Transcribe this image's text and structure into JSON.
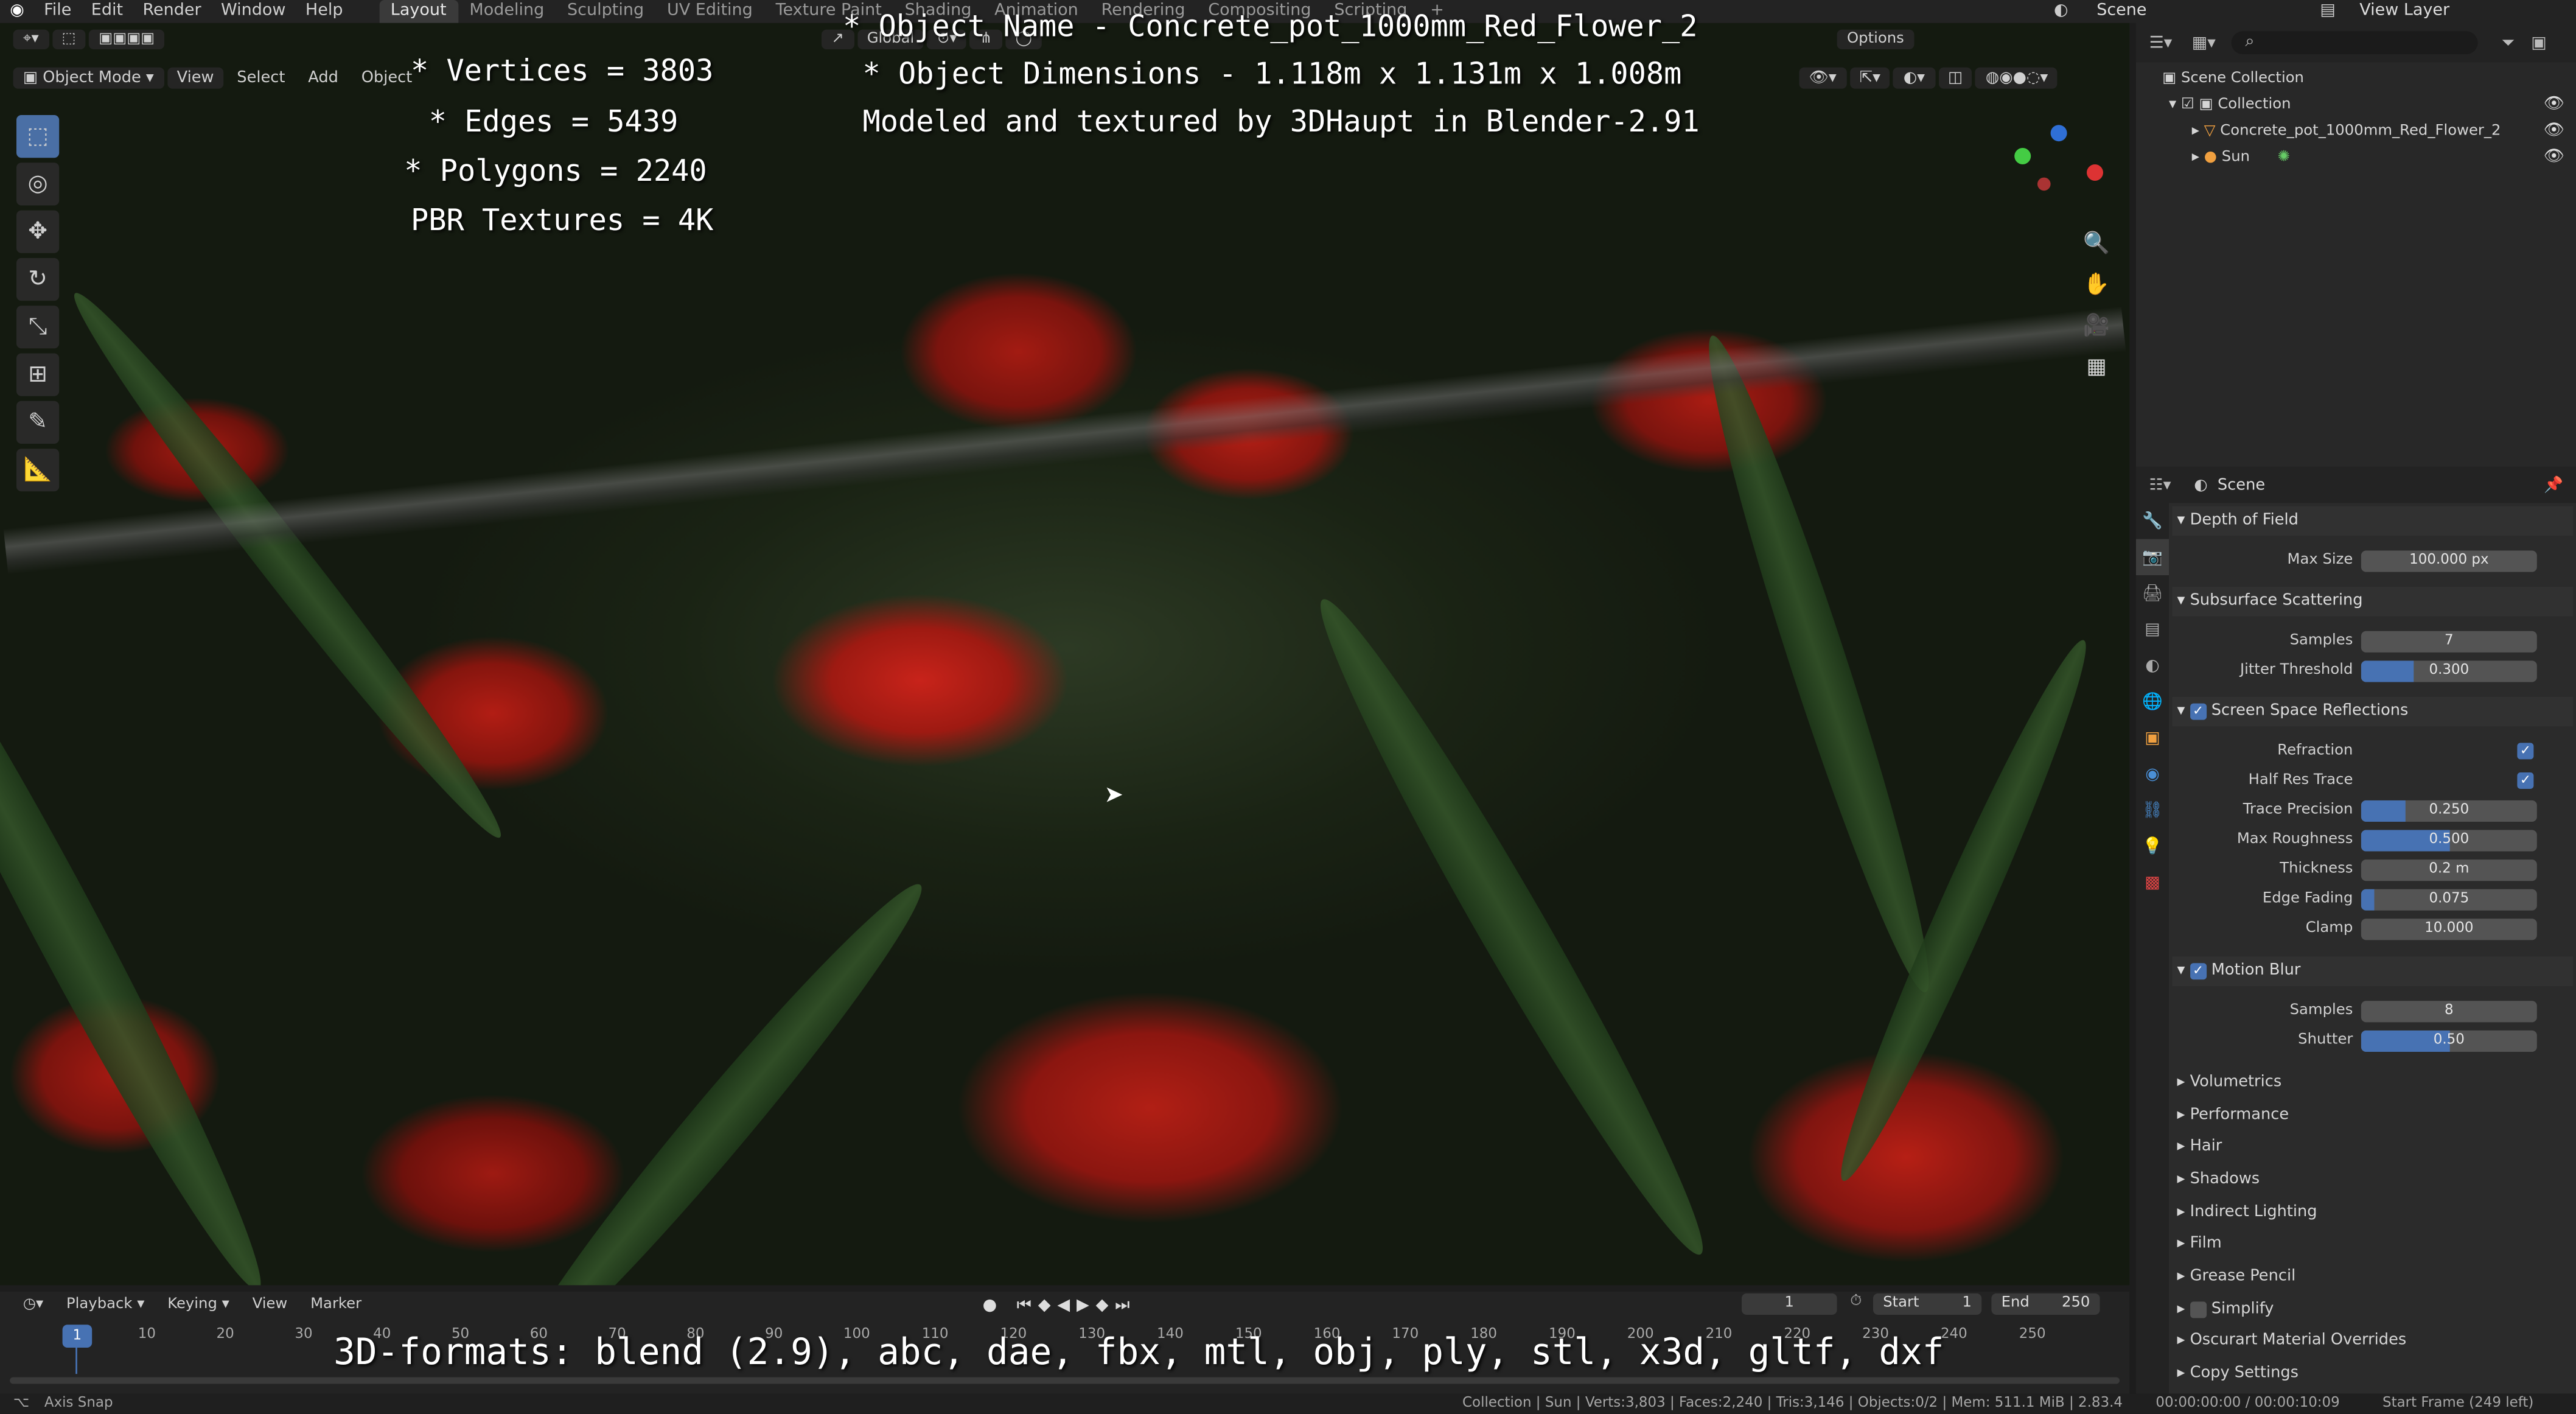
{
  "menu": {
    "items": [
      "File",
      "Edit",
      "Render",
      "Window",
      "Help"
    ]
  },
  "workspaces": [
    "Layout",
    "Modeling",
    "Sculpting",
    "UV Editing",
    "Texture Paint",
    "Shading",
    "Animation",
    "Rendering",
    "Compositing",
    "Scripting"
  ],
  "topright": {
    "scene": "Scene",
    "view_layer": "View Layer"
  },
  "viewport": {
    "mode": "Object Mode",
    "menus": [
      "View",
      "Select",
      "Add",
      "Object"
    ],
    "orientation": "Global",
    "options": "Options"
  },
  "overlay": {
    "object_name": "* Object Name - Concrete_pot_1000mm_Red_Flower_2",
    "dimensions": "* Object Dimensions -  1.118m x 1.131m x 1.008m",
    "credit": "Modeled and textured by 3DHaupt in Blender-2.91",
    "vertices": "* Vertices = 3803",
    "edges": "* Edges = 5439",
    "polygons": "* Polygons = 2240",
    "textures": "PBR Textures = 4K",
    "formats": "3D-formats: blend (2.9), abc, dae, fbx, mtl, obj, ply, stl, x3d, gltf, dxf"
  },
  "outliner": {
    "scene_collection": "Scene Collection",
    "collection": "Collection",
    "object": "Concrete_pot_1000mm_Red_Flower_2",
    "sun": "Sun"
  },
  "properties": {
    "context": "Scene",
    "dof": {
      "title": "Depth of Field",
      "max_size_label": "Max Size",
      "max_size": "100.000 px"
    },
    "sss": {
      "title": "Subsurface Scattering",
      "samples_label": "Samples",
      "samples": "7",
      "jitter_label": "Jitter Threshold",
      "jitter": "0.300",
      "jitter_frac": 0.3
    },
    "ssr": {
      "title": "Screen Space Reflections",
      "refraction": "Refraction",
      "half_res": "Half Res Trace",
      "trace_label": "Trace Precision",
      "trace": "0.250",
      "trace_frac": 0.25,
      "rough_label": "Max Roughness",
      "rough": "0.500",
      "rough_frac": 0.5,
      "thick_label": "Thickness",
      "thick": "0.2 m",
      "edge_label": "Edge Fading",
      "edge": "0.075",
      "edge_frac": 0.075,
      "clamp_label": "Clamp",
      "clamp": "10.000"
    },
    "motion_blur": {
      "title": "Motion Blur",
      "samples_label": "Samples",
      "samples": "8",
      "shutter_label": "Shutter",
      "shutter": "0.50",
      "shutter_frac": 0.5
    },
    "collapsed": [
      "Volumetrics",
      "Performance",
      "Hair",
      "Shadows",
      "Indirect Lighting",
      "Film",
      "Grease Pencil",
      "Simplify",
      "Oscurart Material Overrides",
      "Copy Settings"
    ]
  },
  "timeline": {
    "menus": [
      "Playback",
      "Keying",
      "View",
      "Marker"
    ],
    "current_frame": "1",
    "start_label": "Start",
    "start": "1",
    "end_label": "End",
    "end": "250",
    "ticks": [
      "10",
      "20",
      "30",
      "40",
      "50",
      "60",
      "70",
      "80",
      "90",
      "100",
      "110",
      "120",
      "130",
      "140",
      "150",
      "160",
      "170",
      "180",
      "190",
      "200",
      "210",
      "220",
      "230",
      "240",
      "250"
    ],
    "playhead": "1"
  },
  "status": {
    "left": "Axis Snap",
    "stats": "Collection | Sun | Verts:3,803 | Faces:2,240 | Tris:3,146 | Objects:0/2 | Mem: 511.1 MiB | 2.83.4",
    "time": "00:00:00:00 / 00:00:10:09",
    "start_frame": "Start Frame (249 left)"
  }
}
